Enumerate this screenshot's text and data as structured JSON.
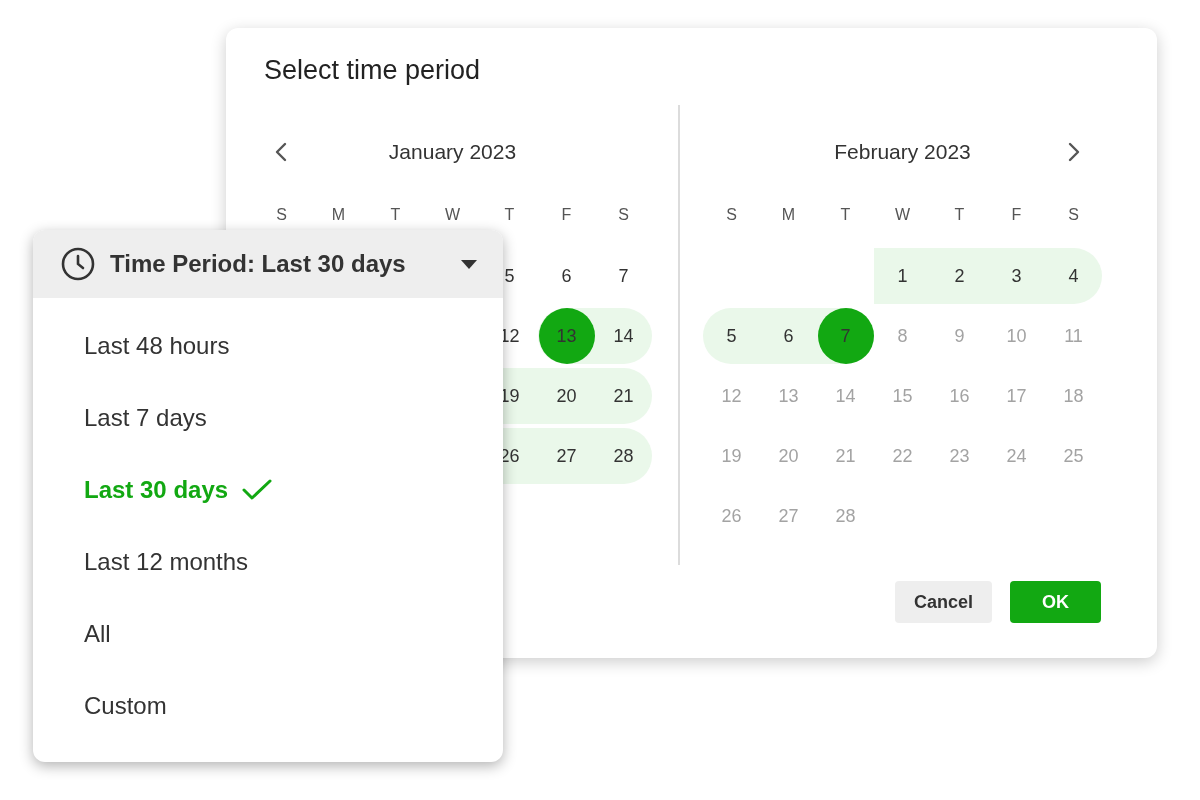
{
  "dialog": {
    "title": "Select time period",
    "months": [
      {
        "label": "January 2023",
        "prev_button": true,
        "next_button": false,
        "weekdays": [
          "S",
          "M",
          "T",
          "W",
          "T",
          "F",
          "S"
        ],
        "weeks": [
          [
            {
              "kind": "blank"
            },
            {
              "kind": "blank"
            },
            {
              "kind": "blank"
            },
            {
              "kind": "blank"
            },
            {
              "kind": "day",
              "label": "5",
              "in_range": false,
              "selected": false,
              "disabled": false
            },
            {
              "kind": "day",
              "label": "6",
              "in_range": false,
              "selected": false,
              "disabled": false
            },
            {
              "kind": "day",
              "label": "7",
              "in_range": false,
              "selected": false,
              "disabled": false
            }
          ],
          [
            {
              "kind": "blank"
            },
            {
              "kind": "blank"
            },
            {
              "kind": "blank"
            },
            {
              "kind": "blank"
            },
            {
              "kind": "day",
              "label": "12",
              "in_range": false,
              "selected": false,
              "disabled": false
            },
            {
              "kind": "day",
              "label": "13",
              "in_range": true,
              "selected": true,
              "disabled": false
            },
            {
              "kind": "day",
              "label": "14",
              "in_range": true,
              "selected": false,
              "disabled": false
            }
          ],
          [
            {
              "kind": "blank"
            },
            {
              "kind": "blank"
            },
            {
              "kind": "blank"
            },
            {
              "kind": "blank"
            },
            {
              "kind": "day",
              "label": "19",
              "in_range": true,
              "selected": false,
              "disabled": false
            },
            {
              "kind": "day",
              "label": "20",
              "in_range": true,
              "selected": false,
              "disabled": false
            },
            {
              "kind": "day",
              "label": "21",
              "in_range": true,
              "selected": false,
              "disabled": false
            }
          ],
          [
            {
              "kind": "blank"
            },
            {
              "kind": "blank"
            },
            {
              "kind": "blank"
            },
            {
              "kind": "blank"
            },
            {
              "kind": "day",
              "label": "26",
              "in_range": true,
              "selected": false,
              "disabled": false
            },
            {
              "kind": "day",
              "label": "27",
              "in_range": true,
              "selected": false,
              "disabled": false
            },
            {
              "kind": "day",
              "label": "28",
              "in_range": true,
              "selected": false,
              "disabled": false
            }
          ]
        ]
      },
      {
        "label": "February 2023",
        "prev_button": false,
        "next_button": true,
        "weekdays": [
          "S",
          "M",
          "T",
          "W",
          "T",
          "F",
          "S"
        ],
        "weeks": [
          [
            {
              "kind": "blank"
            },
            {
              "kind": "blank"
            },
            {
              "kind": "blank"
            },
            {
              "kind": "day",
              "label": "1",
              "in_range": true,
              "selected": false,
              "disabled": false
            },
            {
              "kind": "day",
              "label": "2",
              "in_range": true,
              "selected": false,
              "disabled": false
            },
            {
              "kind": "day",
              "label": "3",
              "in_range": true,
              "selected": false,
              "disabled": false
            },
            {
              "kind": "day",
              "label": "4",
              "in_range": true,
              "selected": false,
              "disabled": false
            }
          ],
          [
            {
              "kind": "day",
              "label": "5",
              "in_range": true,
              "selected": false,
              "disabled": false
            },
            {
              "kind": "day",
              "label": "6",
              "in_range": true,
              "selected": false,
              "disabled": false
            },
            {
              "kind": "day",
              "label": "7",
              "in_range": true,
              "selected": true,
              "disabled": false
            },
            {
              "kind": "day",
              "label": "8",
              "in_range": false,
              "selected": false,
              "disabled": true
            },
            {
              "kind": "day",
              "label": "9",
              "in_range": false,
              "selected": false,
              "disabled": true
            },
            {
              "kind": "day",
              "label": "10",
              "in_range": false,
              "selected": false,
              "disabled": true
            },
            {
              "kind": "day",
              "label": "11",
              "in_range": false,
              "selected": false,
              "disabled": true
            }
          ],
          [
            {
              "kind": "day",
              "label": "12",
              "in_range": false,
              "selected": false,
              "disabled": true
            },
            {
              "kind": "day",
              "label": "13",
              "in_range": false,
              "selected": false,
              "disabled": true
            },
            {
              "kind": "day",
              "label": "14",
              "in_range": false,
              "selected": false,
              "disabled": true
            },
            {
              "kind": "day",
              "label": "15",
              "in_range": false,
              "selected": false,
              "disabled": true
            },
            {
              "kind": "day",
              "label": "16",
              "in_range": false,
              "selected": false,
              "disabled": true
            },
            {
              "kind": "day",
              "label": "17",
              "in_range": false,
              "selected": false,
              "disabled": true
            },
            {
              "kind": "day",
              "label": "18",
              "in_range": false,
              "selected": false,
              "disabled": true
            }
          ],
          [
            {
              "kind": "day",
              "label": "19",
              "in_range": false,
              "selected": false,
              "disabled": true
            },
            {
              "kind": "day",
              "label": "20",
              "in_range": false,
              "selected": false,
              "disabled": true
            },
            {
              "kind": "day",
              "label": "21",
              "in_range": false,
              "selected": false,
              "disabled": true
            },
            {
              "kind": "day",
              "label": "22",
              "in_range": false,
              "selected": false,
              "disabled": true
            },
            {
              "kind": "day",
              "label": "23",
              "in_range": false,
              "selected": false,
              "disabled": true
            },
            {
              "kind": "day",
              "label": "24",
              "in_range": false,
              "selected": false,
              "disabled": true
            },
            {
              "kind": "day",
              "label": "25",
              "in_range": false,
              "selected": false,
              "disabled": true
            }
          ],
          [
            {
              "kind": "day",
              "label": "26",
              "in_range": false,
              "selected": false,
              "disabled": true
            },
            {
              "kind": "day",
              "label": "27",
              "in_range": false,
              "selected": false,
              "disabled": true
            },
            {
              "kind": "day",
              "label": "28",
              "in_range": false,
              "selected": false,
              "disabled": true
            },
            {
              "kind": "blank"
            },
            {
              "kind": "blank"
            },
            {
              "kind": "blank"
            },
            {
              "kind": "blank"
            }
          ]
        ]
      }
    ],
    "buttons": [
      {
        "label": "Cancel",
        "kind": "secondary"
      },
      {
        "label": "OK",
        "kind": "primary"
      }
    ]
  },
  "dropdown": {
    "label": "Time Period: Last 30 days",
    "options": [
      {
        "label": "Last 48 hours",
        "selected": false
      },
      {
        "label": "Last 7 days",
        "selected": false
      },
      {
        "label": "Last 30 days",
        "selected": true
      },
      {
        "label": "Last 12 months",
        "selected": false
      },
      {
        "label": "All",
        "selected": false
      },
      {
        "label": "Custom",
        "selected": false
      }
    ]
  }
}
